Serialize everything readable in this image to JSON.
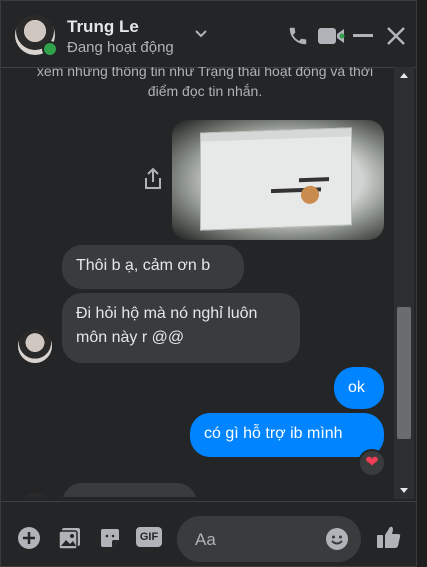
{
  "header": {
    "name": "Trung Le",
    "status": "Đang hoạt động"
  },
  "icons": {
    "header": [
      "chevron-down-icon",
      "phone-icon",
      "video-camera-icon",
      "minimize-icon",
      "close-icon"
    ],
    "composer": [
      "add-icon",
      "image-icon",
      "sticker-icon",
      "gif-icon",
      "emoji-icon",
      "thumbs-up-icon"
    ],
    "message": [
      "share-icon",
      "heart-reaction-icon"
    ]
  },
  "system_text": "xem những thông tin như Trạng thái hoạt động và thời điểm đọc tin nhắn.",
  "messages": {
    "in_1": "Thôi b ạ, cảm ơn b",
    "in_2": "Đi hỏi hộ mà nó nghỉ luôn môn này r @@",
    "out_1": "ok",
    "out_2": "có gì hỗ trợ ib mình",
    "reaction": "❤"
  },
  "composer": {
    "placeholder": "Aa",
    "gif_label": "GIF"
  },
  "colors": {
    "accent": "#0084ff",
    "online": "#31a24c",
    "reaction": "#f33e58"
  }
}
